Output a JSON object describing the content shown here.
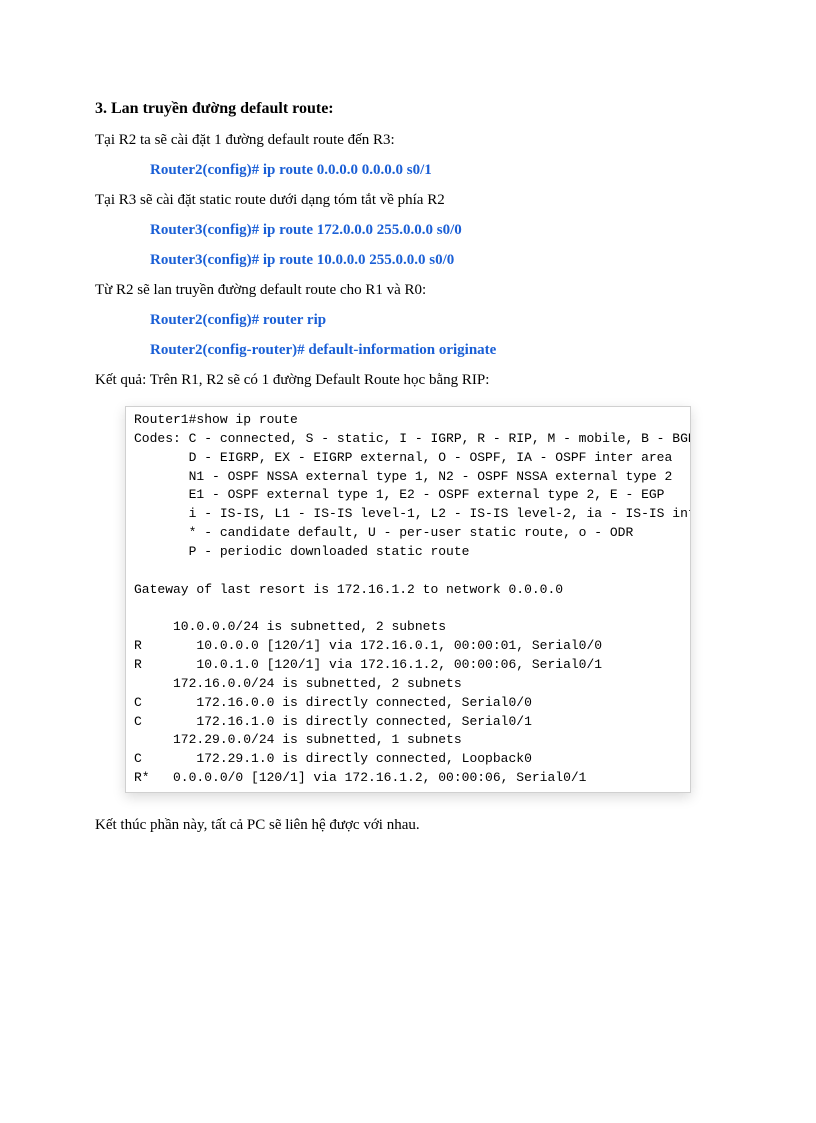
{
  "heading": "3.  Lan truyền đường default route:",
  "para1": "Tại R2 ta sẽ cài đặt 1 đường default route đến R3:",
  "cmd1": "Router2(config)# ip route 0.0.0.0   0.0.0.0   s0/1",
  "para2": "Tại R3 sẽ cài đặt static route dưới dạng tóm tắt về phía R2",
  "cmd2": "Router3(config)# ip route 172.0.0.0 255.0.0.0 s0/0",
  "cmd3": "Router3(config)# ip route 10.0.0.0 255.0.0.0 s0/0",
  "para3": "Từ R2 sẽ lan truyền đường default route cho R1 và R0:",
  "cmd4": "Router2(config)# router rip",
  "cmd5": "Router2(config-router)# default-information originate",
  "para4": "Kết quả: Trên R1, R2 sẽ có 1 đường Default Route học bằng RIP:",
  "terminal": "Router1#show ip route\nCodes: C - connected, S - static, I - IGRP, R - RIP, M - mobile, B - BGP\n       D - EIGRP, EX - EIGRP external, O - OSPF, IA - OSPF inter area\n       N1 - OSPF NSSA external type 1, N2 - OSPF NSSA external type 2\n       E1 - OSPF external type 1, E2 - OSPF external type 2, E - EGP\n       i - IS-IS, L1 - IS-IS level-1, L2 - IS-IS level-2, ia - IS-IS inter area\n       * - candidate default, U - per-user static route, o - ODR\n       P - periodic downloaded static route\n\nGateway of last resort is 172.16.1.2 to network 0.0.0.0\n\n     10.0.0.0/24 is subnetted, 2 subnets\nR       10.0.0.0 [120/1] via 172.16.0.1, 00:00:01, Serial0/0\nR       10.0.1.0 [120/1] via 172.16.1.2, 00:00:06, Serial0/1\n     172.16.0.0/24 is subnetted, 2 subnets\nC       172.16.0.0 is directly connected, Serial0/0\nC       172.16.1.0 is directly connected, Serial0/1\n     172.29.0.0/24 is subnetted, 1 subnets\nC       172.29.1.0 is directly connected, Loopback0\nR*   0.0.0.0/0 [120/1] via 172.16.1.2, 00:00:06, Serial0/1",
  "para5": "Kết thúc phần này, tất cả PC sẽ liên hệ được với nhau."
}
